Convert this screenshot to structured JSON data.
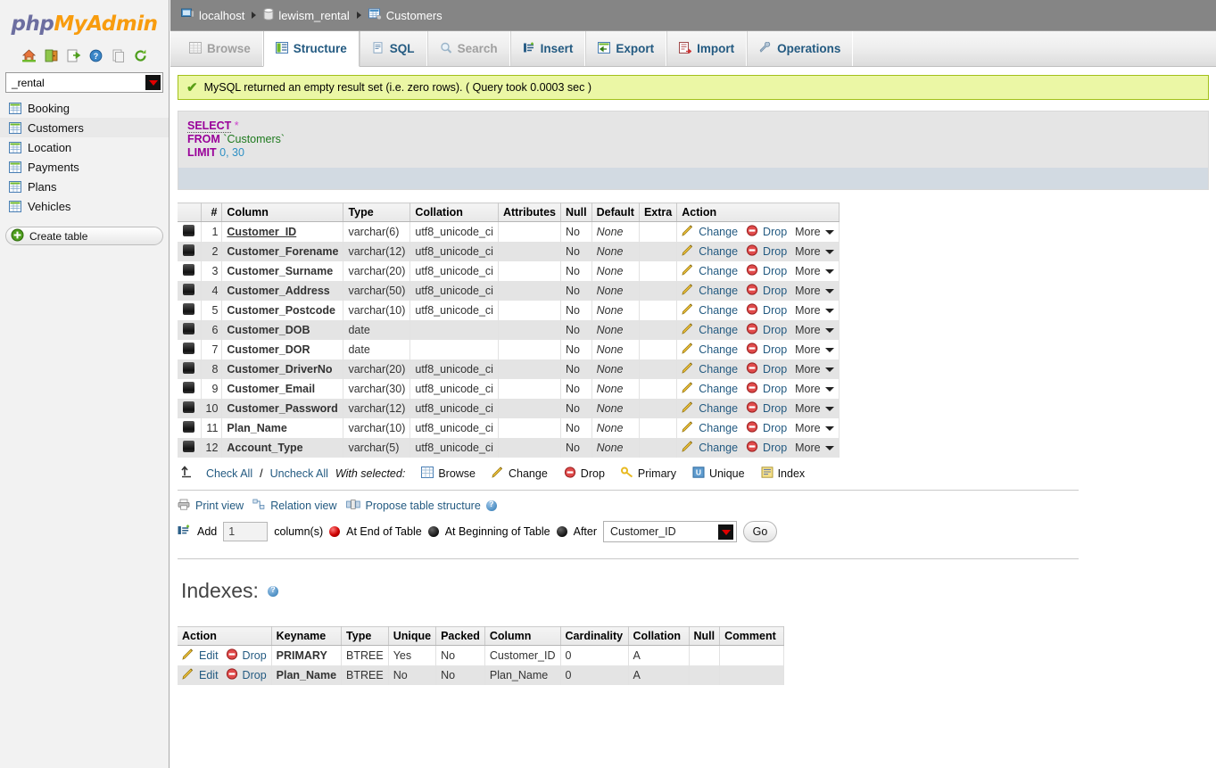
{
  "app": {
    "logo_php": "php",
    "logo_my": "My",
    "logo_admin": "Admin"
  },
  "sidebar": {
    "icons": [
      {
        "name": "home-icon",
        "title": "Home"
      },
      {
        "name": "logout-icon",
        "title": "Log out"
      },
      {
        "name": "export-icon",
        "title": "Export"
      },
      {
        "name": "help-icon",
        "title": "Documentation"
      },
      {
        "name": "copy-icon",
        "title": "Copy"
      },
      {
        "name": "reload-icon",
        "title": "Reload"
      }
    ],
    "db_select": {
      "value": "_rental"
    },
    "tables": [
      {
        "label": "Booking",
        "active": false
      },
      {
        "label": "Customers",
        "active": true
      },
      {
        "label": "Location",
        "active": false
      },
      {
        "label": "Payments",
        "active": false
      },
      {
        "label": "Plans",
        "active": false
      },
      {
        "label": "Vehicles",
        "active": false
      }
    ],
    "create_table_label": "Create table"
  },
  "breadcrumb": [
    {
      "label": "localhost",
      "icon": "server-icon"
    },
    {
      "label": "lewism_rental",
      "icon": "database-icon"
    },
    {
      "label": "Customers",
      "icon": "table-icon"
    }
  ],
  "tabs": [
    {
      "label": "Browse",
      "icon": "browse-icon",
      "state": "disabled"
    },
    {
      "label": "Structure",
      "icon": "structure-icon",
      "state": "active"
    },
    {
      "label": "SQL",
      "icon": "sql-icon",
      "state": "normal"
    },
    {
      "label": "Search",
      "icon": "search-icon",
      "state": "disabled"
    },
    {
      "label": "Insert",
      "icon": "insert-icon",
      "state": "normal"
    },
    {
      "label": "Export",
      "icon": "export-icon",
      "state": "normal"
    },
    {
      "label": "Import",
      "icon": "import-icon",
      "state": "normal"
    },
    {
      "label": "Operations",
      "icon": "operations-icon",
      "state": "normal"
    }
  ],
  "status": {
    "message": "MySQL returned an empty result set (i.e. zero rows). ( Query took 0.0003 sec )",
    "check_icon": "✔",
    "bg": "#ebf7a5",
    "border": "#a2c11a"
  },
  "sql": {
    "line1_kw": "SELECT",
    "line1_star": "*",
    "line2_kw": "FROM",
    "line2_ident": "`Customers`",
    "line3_kw": "LIMIT",
    "line3_a": "0",
    "line3_comma": ",",
    "line3_b": "30"
  },
  "structure": {
    "headers": [
      "",
      "#",
      "Column",
      "Type",
      "Collation",
      "Attributes",
      "Null",
      "Default",
      "Extra",
      "Action"
    ],
    "rows": [
      {
        "num": "1",
        "column": "Customer_ID",
        "type": "varchar(6)",
        "collation": "utf8_unicode_ci",
        "attributes": "",
        "null": "No",
        "default": "None",
        "extra": "",
        "pk": true
      },
      {
        "num": "2",
        "column": "Customer_Forename",
        "type": "varchar(12)",
        "collation": "utf8_unicode_ci",
        "attributes": "",
        "null": "No",
        "default": "None",
        "extra": "",
        "pk": false
      },
      {
        "num": "3",
        "column": "Customer_Surname",
        "type": "varchar(20)",
        "collation": "utf8_unicode_ci",
        "attributes": "",
        "null": "No",
        "default": "None",
        "extra": "",
        "pk": false
      },
      {
        "num": "4",
        "column": "Customer_Address",
        "type": "varchar(50)",
        "collation": "utf8_unicode_ci",
        "attributes": "",
        "null": "No",
        "default": "None",
        "extra": "",
        "pk": false
      },
      {
        "num": "5",
        "column": "Customer_Postcode",
        "type": "varchar(10)",
        "collation": "utf8_unicode_ci",
        "attributes": "",
        "null": "No",
        "default": "None",
        "extra": "",
        "pk": false
      },
      {
        "num": "6",
        "column": "Customer_DOB",
        "type": "date",
        "collation": "",
        "attributes": "",
        "null": "No",
        "default": "None",
        "extra": "",
        "pk": false
      },
      {
        "num": "7",
        "column": "Customer_DOR",
        "type": "date",
        "collation": "",
        "attributes": "",
        "null": "No",
        "default": "None",
        "extra": "",
        "pk": false
      },
      {
        "num": "8",
        "column": "Customer_DriverNo",
        "type": "varchar(20)",
        "collation": "utf8_unicode_ci",
        "attributes": "",
        "null": "No",
        "default": "None",
        "extra": "",
        "pk": false
      },
      {
        "num": "9",
        "column": "Customer_Email",
        "type": "varchar(30)",
        "collation": "utf8_unicode_ci",
        "attributes": "",
        "null": "No",
        "default": "None",
        "extra": "",
        "pk": false
      },
      {
        "num": "10",
        "column": "Customer_Password",
        "type": "varchar(12)",
        "collation": "utf8_unicode_ci",
        "attributes": "",
        "null": "No",
        "default": "None",
        "extra": "",
        "pk": false
      },
      {
        "num": "11",
        "column": "Plan_Name",
        "type": "varchar(10)",
        "collation": "utf8_unicode_ci",
        "attributes": "",
        "null": "No",
        "default": "None",
        "extra": "",
        "pk": false
      },
      {
        "num": "12",
        "column": "Account_Type",
        "type": "varchar(5)",
        "collation": "utf8_unicode_ci",
        "attributes": "",
        "null": "No",
        "default": "None",
        "extra": "",
        "pk": false
      }
    ],
    "row_action_change": "Change",
    "row_action_drop": "Drop",
    "row_action_more": "More"
  },
  "with_selected": {
    "check_all": "Check All",
    "separator": "/",
    "uncheck_all": "Uncheck All",
    "label": "With selected:",
    "actions": [
      {
        "label": "Browse",
        "icon": "browse-icon"
      },
      {
        "label": "Change",
        "icon": "pencil-icon"
      },
      {
        "label": "Drop",
        "icon": "drop-icon"
      },
      {
        "label": "Primary",
        "icon": "key-icon"
      },
      {
        "label": "Unique",
        "icon": "unique-icon"
      },
      {
        "label": "Index",
        "icon": "index-icon"
      }
    ]
  },
  "print_row": {
    "print_view": "Print view",
    "relation_view": "Relation view",
    "propose_structure": "Propose table structure"
  },
  "add_row": {
    "add_label": "Add",
    "count_value": "1",
    "columns_label": "column(s)",
    "at_end": "At End of Table",
    "at_beginning": "At Beginning of Table",
    "after": "After",
    "after_value": "Customer_ID",
    "go_label": "Go"
  },
  "indexes": {
    "title": "Indexes:",
    "headers": [
      "Action",
      "Keyname",
      "Type",
      "Unique",
      "Packed",
      "Column",
      "Cardinality",
      "Collation",
      "Null",
      "Comment"
    ],
    "rows": [
      {
        "edit": "Edit",
        "drop": "Drop",
        "keyname": "PRIMARY",
        "type": "BTREE",
        "unique": "Yes",
        "packed": "No",
        "column": "Customer_ID",
        "cardinality": "0",
        "collation": "A",
        "null": "",
        "comment": ""
      },
      {
        "edit": "Edit",
        "drop": "Drop",
        "keyname": "Plan_Name",
        "type": "BTREE",
        "unique": "No",
        "packed": "No",
        "column": "Plan_Name",
        "cardinality": "0",
        "collation": "A",
        "null": "",
        "comment": ""
      }
    ]
  },
  "colors": {
    "link": "#235a81",
    "breadcrumb_bg": "#858585",
    "success_bg": "#ebf7a5",
    "sql_bg": "#e5e5e5",
    "row_even": "#e4e4e4"
  }
}
